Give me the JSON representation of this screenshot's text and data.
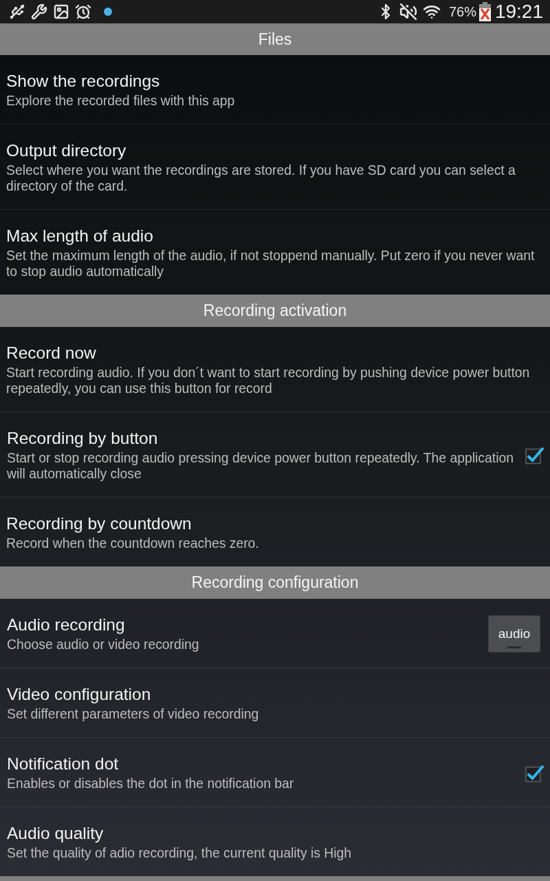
{
  "status_bar": {
    "battery_percent": "76%",
    "time": "19:21"
  },
  "sections": [
    {
      "title": "Files",
      "items": [
        {
          "kind": "plain",
          "title": "Show the recordings",
          "summary": "Explore the recorded files with this app"
        },
        {
          "kind": "plain",
          "title": "Output directory",
          "summary": "Select where you want the recordings are stored. If you have SD card you can select a directory of the card."
        },
        {
          "kind": "plain",
          "title": "Max length of audio",
          "summary": "Set the maximum length of the audio, if not stoppend manually. Put zero if you never want to stop audio automatically"
        }
      ]
    },
    {
      "title": "Recording activation",
      "items": [
        {
          "kind": "plain",
          "title": "Record now",
          "summary": "Start recording audio. If you don´t want to start recording by pushing device power button repeatedly, you can use this button for record"
        },
        {
          "kind": "checkbox",
          "title": "Recording by button",
          "summary": "Start or stop recording audio pressing device power button repeatedly. The application will automatically close",
          "checked": true
        },
        {
          "kind": "plain",
          "title": "Recording by countdown",
          "summary": "Record when the countdown reaches zero."
        }
      ]
    },
    {
      "title": "Recording configuration",
      "items": [
        {
          "kind": "button",
          "title": "Audio recording",
          "summary": "Choose audio or video recording",
          "button_label": "audio"
        },
        {
          "kind": "plain",
          "title": "Video configuration",
          "summary": "Set different parameters of video recording"
        },
        {
          "kind": "checkbox",
          "title": "Notification dot",
          "summary": "Enables or disables the dot in the notification bar",
          "checked": true
        },
        {
          "kind": "plain",
          "title": "Audio quality",
          "summary": "Set the quality of adio recording, the current quality is High"
        }
      ]
    }
  ],
  "next_section_header_cut_off": true
}
